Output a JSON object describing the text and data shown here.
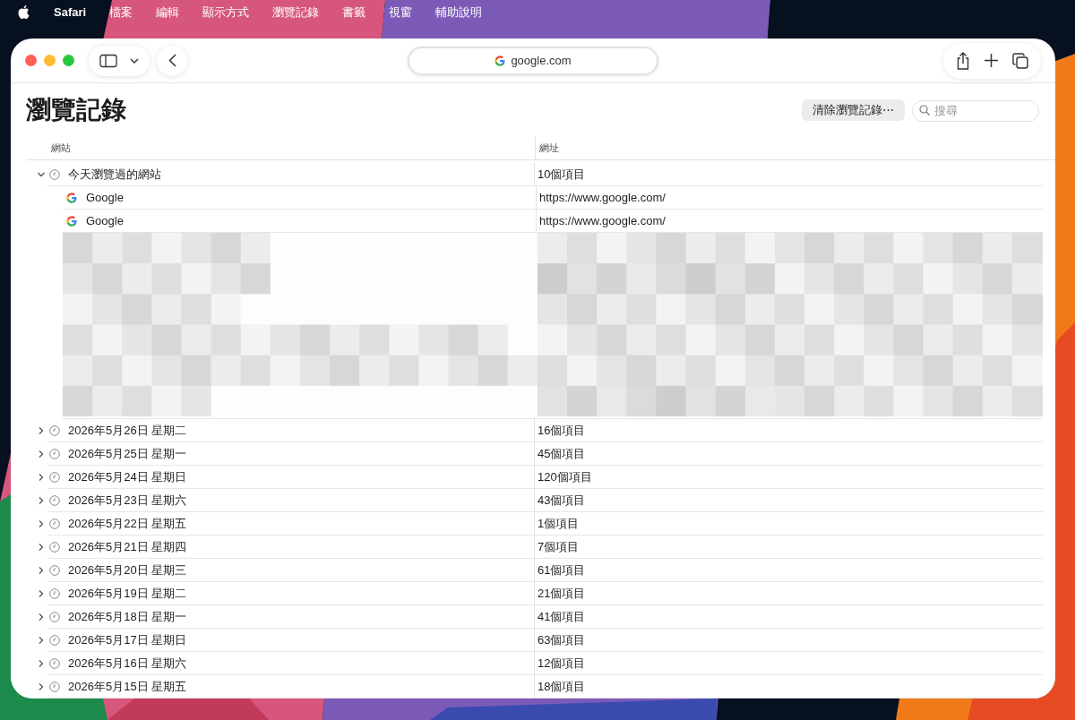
{
  "menu_bar": {
    "app": "Safari",
    "items": [
      "檔案",
      "編輯",
      "顯示方式",
      "瀏覽記錄",
      "書籤",
      "視窗",
      "輔助說明"
    ]
  },
  "toolbar": {
    "address": "google.com"
  },
  "page": {
    "title": "瀏覽記錄",
    "clear_button": "清除瀏覽記錄⋯",
    "search": {
      "placeholder": "搜尋"
    }
  },
  "table": {
    "columns": [
      "網站",
      "網址"
    ],
    "rows": [
      {
        "title": "今天瀏覽過的網站",
        "address": "10個項目",
        "expanded": true,
        "children": [
          {
            "kind": "site",
            "title": "Google",
            "address": "https://www.google.com/"
          },
          {
            "kind": "site",
            "title": "Google",
            "address": "https://www.google.com/"
          },
          {
            "kind": "picture"
          }
        ]
      },
      {
        "title": "2026年5月26日 星期二",
        "address": "16個項目",
        "expanded": false
      },
      {
        "title": "2026年5月25日 星期一",
        "address": "45個項目",
        "expanded": false
      },
      {
        "title": "2026年5月24日 星期日",
        "address": "120個項目",
        "expanded": false
      },
      {
        "title": "2026年5月23日 星期六",
        "address": "43個項目",
        "expanded": false
      },
      {
        "title": "2026年5月22日 星期五",
        "address": "1個項目",
        "expanded": false
      },
      {
        "title": "2026年5月21日 星期四",
        "address": "7個項目",
        "expanded": false
      },
      {
        "title": "2026年5月20日 星期三",
        "address": "61個項目",
        "expanded": false
      },
      {
        "title": "2026年5月19日 星期二",
        "address": "21個項目",
        "expanded": false
      },
      {
        "title": "2026年5月18日 星期一",
        "address": "41個項目",
        "expanded": false
      },
      {
        "title": "2026年5月17日 星期日",
        "address": "63個項目",
        "expanded": false
      },
      {
        "title": "2026年5月16日 星期六",
        "address": "12個項目",
        "expanded": false
      },
      {
        "title": "2026年5月15日 星期五",
        "address": "18個項目",
        "expanded": false
      }
    ]
  }
}
